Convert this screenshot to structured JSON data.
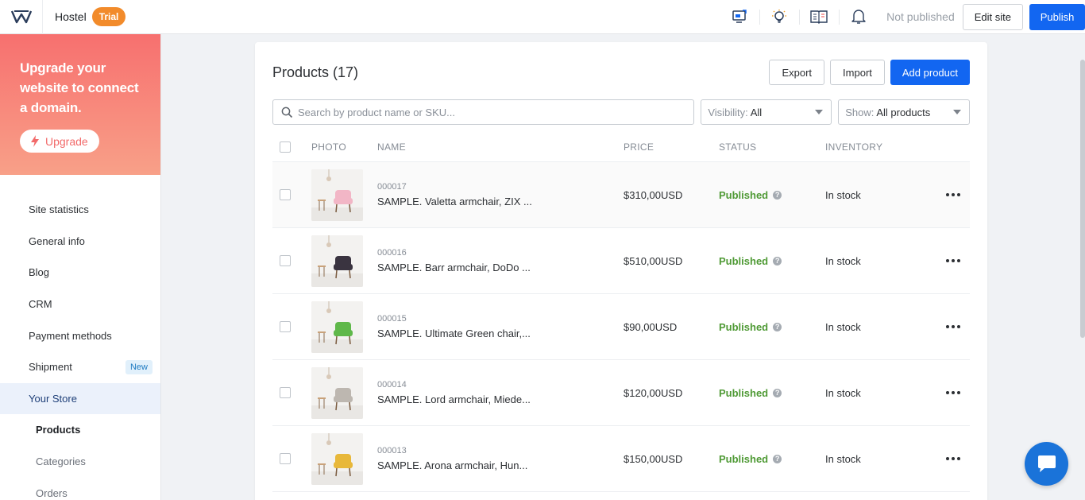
{
  "topbar": {
    "site_name": "Hostel",
    "plan_badge": "Trial",
    "publish_status": "Not published",
    "edit_site_label": "Edit site",
    "publish_label": "Publish"
  },
  "sidebar": {
    "upgrade_text": "Upgrade your website to connect a domain.",
    "upgrade_button": "Upgrade",
    "items": [
      {
        "label": "Site statistics"
      },
      {
        "label": "General info"
      },
      {
        "label": "Blog"
      },
      {
        "label": "CRM"
      },
      {
        "label": "Payment methods"
      },
      {
        "label": "Shipment",
        "badge": "New"
      },
      {
        "label": "Your Store"
      },
      {
        "label": "Products"
      },
      {
        "label": "Categories"
      },
      {
        "label": "Orders"
      }
    ]
  },
  "products": {
    "title": "Products (17)",
    "export_label": "Export",
    "import_label": "Import",
    "add_label": "Add product",
    "search_placeholder": "Search by product name or SKU...",
    "visibility_label": "Visibility:",
    "visibility_value": "All",
    "show_label": "Show:",
    "show_value": "All products",
    "columns": {
      "photo": "PHOTO",
      "name": "NAME",
      "price": "PRICE",
      "status": "STATUS",
      "inventory": "INVENTORY"
    },
    "rows": [
      {
        "sku": "000017",
        "name": "SAMPLE. Valetta armchair, ZIX ...",
        "price": "$310,00USD",
        "status": "Published",
        "inventory": "In stock",
        "chair_color": "#f2b6c6"
      },
      {
        "sku": "000016",
        "name": "SAMPLE. Barr armchair, DoDo ...",
        "price": "$510,00USD",
        "status": "Published",
        "inventory": "In stock",
        "chair_color": "#3a3440"
      },
      {
        "sku": "000015",
        "name": "SAMPLE. Ultimate Green chair,...",
        "price": "$90,00USD",
        "status": "Published",
        "inventory": "In stock",
        "chair_color": "#5fb84a"
      },
      {
        "sku": "000014",
        "name": "SAMPLE. Lord armchair, Miede...",
        "price": "$120,00USD",
        "status": "Published",
        "inventory": "In stock",
        "chair_color": "#bdb7b0"
      },
      {
        "sku": "000013",
        "name": "SAMPLE. Arona armchair, Hun...",
        "price": "$150,00USD",
        "status": "Published",
        "inventory": "In stock",
        "chair_color": "#e8b83a"
      }
    ]
  },
  "colors": {
    "accent": "#1266f1",
    "published": "#4f9a35",
    "trial": "#f28b2b",
    "chat": "#1a73d9"
  }
}
